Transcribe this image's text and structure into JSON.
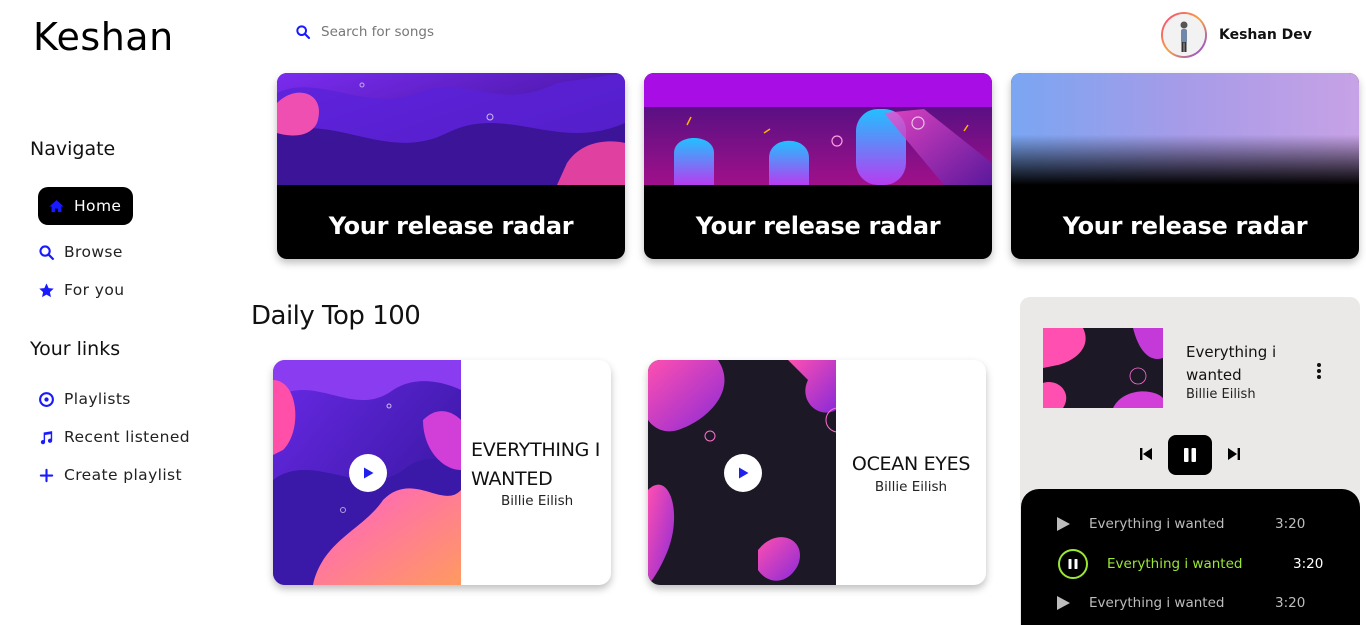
{
  "app": {
    "logo": "Keshan"
  },
  "search": {
    "placeholder": "Search for songs"
  },
  "profile": {
    "name": "Keshan Dev"
  },
  "sidebar": {
    "navigate_heading": "Navigate",
    "navigate_items": [
      {
        "label": "Home",
        "icon": "home-icon",
        "active": true
      },
      {
        "label": "Browse",
        "icon": "search-icon"
      },
      {
        "label": "For you",
        "icon": "star-icon"
      }
    ],
    "links_heading": "Your links",
    "links_items": [
      {
        "label": "Playlists",
        "icon": "disc-icon"
      },
      {
        "label": "Recent listened",
        "icon": "music-note-icon"
      },
      {
        "label": "Create playlist",
        "icon": "plus-icon"
      }
    ]
  },
  "radar_cards": [
    {
      "title": "Your release radar"
    },
    {
      "title": "Your release radar"
    },
    {
      "title": "Your release radar"
    }
  ],
  "daily": {
    "heading": "Daily Top 100",
    "songs": [
      {
        "title": "EVERYTHING I WANTED",
        "artist": "Billie Eilish"
      },
      {
        "title": "OCEAN EYES",
        "artist": "Billie Eilish"
      }
    ]
  },
  "player": {
    "title": "Everything i wanted",
    "artist": "Billie Eilish"
  },
  "queue": [
    {
      "title": "Everything i wanted",
      "duration": "3:20",
      "playing": false
    },
    {
      "title": "Everything i wanted",
      "duration": "3:20",
      "playing": true
    },
    {
      "title": "Everything i wanted",
      "duration": "3:20",
      "playing": false
    }
  ],
  "colors": {
    "accent": "#1a1aff",
    "playing": "#9be635"
  }
}
